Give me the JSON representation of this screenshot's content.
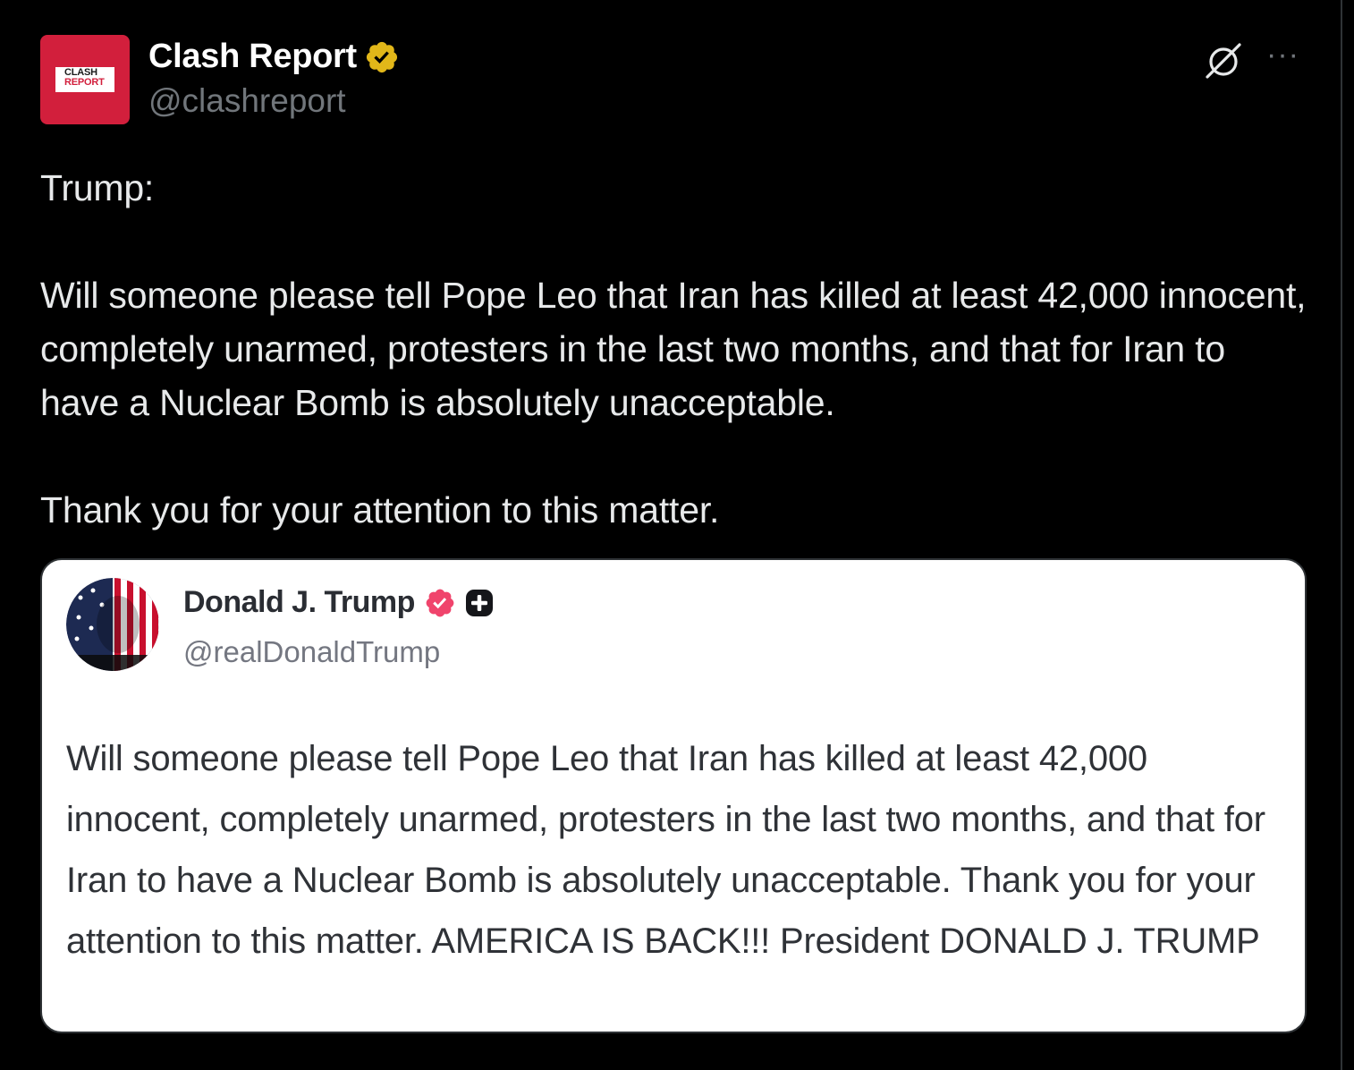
{
  "post": {
    "author": {
      "display_name": "Clash Report",
      "handle": "@clashreport",
      "avatar_line1": "CLASH",
      "avatar_line2": "REPORT",
      "verified_color": "#e2b719"
    },
    "text": {
      "line1": "Trump:",
      "line2": "Will someone please tell Pope Leo that Iran has killed at least 42,000 innocent, completely unarmed, protesters in the last two months, and that for Iran to have a Nuclear Bomb is absolutely unacceptable.",
      "line3": "Thank you for your attention to this matter."
    },
    "icons": {
      "grok": "grok-icon",
      "more": "more-options-icon"
    }
  },
  "media": {
    "author": {
      "display_name": "Donald J. Trump",
      "handle": "@realDonaldTrump",
      "verified_color": "#f0446c"
    },
    "text": "Will someone please tell Pope Leo that Iran has killed at least 42,000 innocent, completely unarmed, protesters in the last two months, and that for Iran to have a Nuclear Bomb is absolutely unacceptable. Thank you for your attention to this matter. AMERICA IS BACK!!! President DONALD J. TRUMP"
  },
  "colors": {
    "background": "#000000",
    "text_primary": "#e7e9ea",
    "text_secondary": "#71767b",
    "brand_red": "#d21f3c"
  }
}
